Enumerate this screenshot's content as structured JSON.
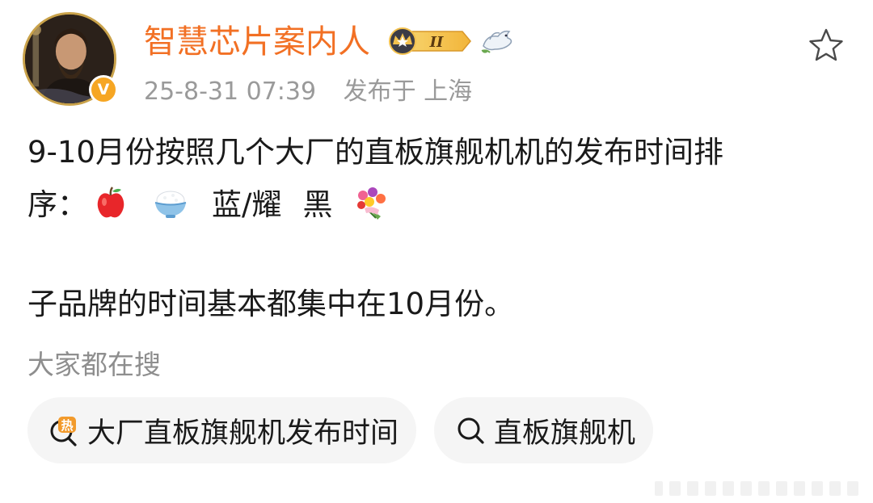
{
  "user": {
    "name": "智慧芯片案内人",
    "rank_label": "II",
    "verified_mark": "V"
  },
  "post": {
    "timestamp": "25-8-31 07:39",
    "location": "发布于 上海",
    "line1": "9-10月份按照几个大厂的直板旗舰机机的发布时间排",
    "line2_prefix": "序：",
    "line2_brands": "蓝/耀",
    "line2_black": "黑",
    "line3": "子品牌的时间基本都集中在10月份。",
    "emojis": [
      "apple-emoji",
      "rice-bowl-emoji",
      "bouquet-emoji"
    ]
  },
  "search": {
    "section_label": "大家都在搜",
    "chips": [
      {
        "label": "大厂直板旗舰机发布时间",
        "icon": "hot-search-icon"
      },
      {
        "label": "直板旗舰机",
        "icon": "search-icon"
      }
    ]
  },
  "colors": {
    "username": "#f27024",
    "meta": "#9a9a9a",
    "body_text": "#1a1a1a",
    "chip_bg": "#f5f5f5",
    "hot_icon": "#f29a2b"
  }
}
